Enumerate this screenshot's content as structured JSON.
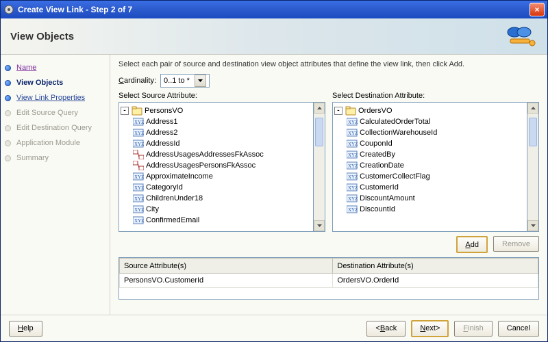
{
  "window": {
    "title": "Create View Link - Step 2 of 7"
  },
  "banner": {
    "heading": "View Objects"
  },
  "nav": {
    "steps": [
      {
        "label": "Name",
        "state": "done"
      },
      {
        "label": "View Objects",
        "state": "current"
      },
      {
        "label": "View Link Properties",
        "state": "link"
      },
      {
        "label": "Edit Source Query",
        "state": "future"
      },
      {
        "label": "Edit Destination Query",
        "state": "future"
      },
      {
        "label": "Application Module",
        "state": "future"
      },
      {
        "label": "Summary",
        "state": "future"
      }
    ]
  },
  "main": {
    "instruction": "Select each pair of source and destination view object attributes that define the view link, then click Add.",
    "cardinality": {
      "label": "Cardinality:",
      "value": "0..1 to *"
    },
    "source": {
      "caption": "Select Source Attribute:",
      "root": "PersonsVO",
      "items": [
        {
          "label": "Address1",
          "kind": "attr"
        },
        {
          "label": "Address2",
          "kind": "attr"
        },
        {
          "label": "AddressId",
          "kind": "attr"
        },
        {
          "label": "AddressUsagesAddressesFkAssoc",
          "kind": "assoc"
        },
        {
          "label": "AddressUsagesPersonsFkAssoc",
          "kind": "assoc"
        },
        {
          "label": "ApproximateIncome",
          "kind": "attr"
        },
        {
          "label": "CategoryId",
          "kind": "attr"
        },
        {
          "label": "ChildrenUnder18",
          "kind": "attr"
        },
        {
          "label": "City",
          "kind": "attr"
        },
        {
          "label": "ConfirmedEmail",
          "kind": "attr"
        }
      ]
    },
    "dest": {
      "caption": "Select Destination Attribute:",
      "root": "OrdersVO",
      "items": [
        {
          "label": "CalculatedOrderTotal",
          "kind": "attr"
        },
        {
          "label": "CollectionWarehouseId",
          "kind": "attr"
        },
        {
          "label": "CouponId",
          "kind": "attr"
        },
        {
          "label": "CreatedBy",
          "kind": "attr"
        },
        {
          "label": "CreationDate",
          "kind": "attr"
        },
        {
          "label": "CustomerCollectFlag",
          "kind": "attr"
        },
        {
          "label": "CustomerId",
          "kind": "attr"
        },
        {
          "label": "DiscountAmount",
          "kind": "attr"
        },
        {
          "label": "DiscountId",
          "kind": "attr"
        }
      ]
    },
    "buttons": {
      "add": "Add",
      "remove": "Remove"
    },
    "grid": {
      "headers": {
        "src": "Source Attribute(s)",
        "dst": "Destination Attribute(s)"
      },
      "rows": [
        {
          "src": "PersonsVO.CustomerId",
          "dst": "OrdersVO.OrderId"
        }
      ]
    }
  },
  "footer": {
    "help": "Help",
    "back": "Back",
    "next": "Next",
    "finish": "Finish",
    "cancel": "Cancel"
  }
}
